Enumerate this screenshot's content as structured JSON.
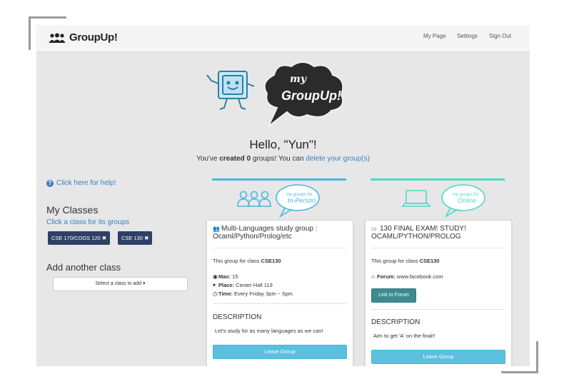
{
  "brand": {
    "name": "GroupUp!"
  },
  "nav": {
    "my_page": "My Page",
    "settings": "Settings",
    "sign_out": "Sign Out"
  },
  "hero": {
    "line1": "my",
    "line2": "GroupUp!"
  },
  "greeting": {
    "hello": "Hello, \"Yun\"!",
    "pre": "You've ",
    "created": "created",
    "count": "0",
    "mid": " groups! You can ",
    "link": "delete your group(s)"
  },
  "sidebar": {
    "help": "Click here for help!",
    "my_classes": "My Classes",
    "click_class": "Click a class for its groups",
    "classes": [
      "CSE 170/COGS 120 ✖",
      "CSE 130 ✖"
    ],
    "add_class": "Add another class",
    "select_label": "Select a class to add ▾"
  },
  "columns": {
    "inperson": {
      "label1": "my groups for",
      "label2": "In-Person",
      "color": "#4cb7dd"
    },
    "online": {
      "label1": "my groups for",
      "label2": "Online",
      "color": "#4ddac6"
    }
  },
  "cards": {
    "inperson": {
      "title": "Multi-Languages study group : Ocaml/Python/Prolog/etc",
      "class_pre": "This group for class ",
      "class_code": "CSE130",
      "max_label": "Max:",
      "max_value": " 15",
      "place_label": "Place:",
      "place_value": " Center Hall 119",
      "time_label": "Time:",
      "time_value": " Every Friday 3pm ~ 5pm",
      "desc_heading": "DESCRIPTION",
      "desc_text": "Let's study for as many languages as we can!",
      "leave": "Leave Group"
    },
    "online": {
      "title": "130 FINAL EXAM! STUDY! OCAML/PYTHON/PROLOG",
      "class_pre": "This group for class ",
      "class_code": "CSE130",
      "forum_label": "Forum:",
      "forum_value": " www.facebook.com",
      "link_forum": "Link to Forum",
      "desc_heading": "DESCRIPTION",
      "desc_text": "Aim to get 'A' on the final!!",
      "leave": "Leave Group"
    }
  }
}
